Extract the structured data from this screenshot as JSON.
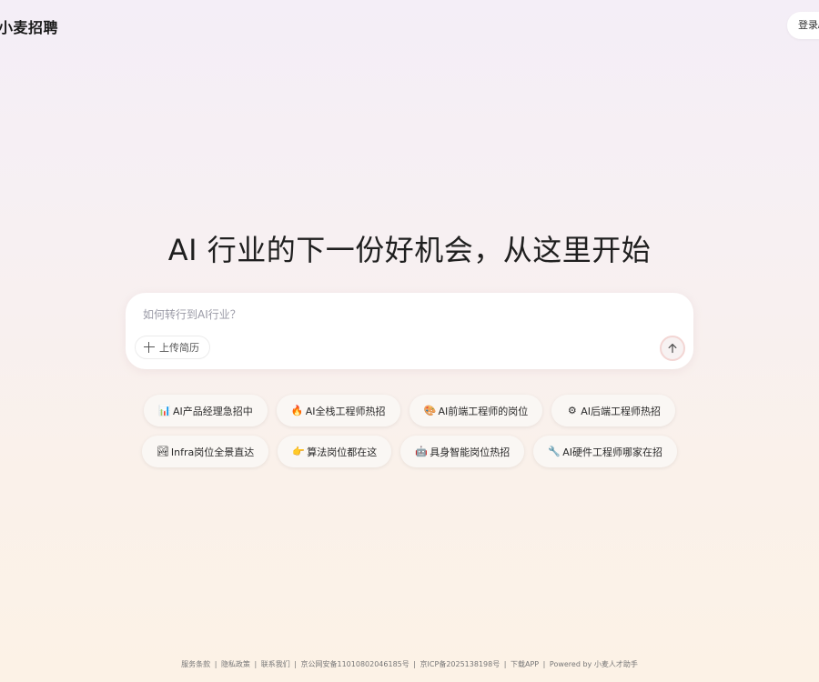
{
  "header": {
    "logo": "小麦招聘",
    "login_label": "登录/"
  },
  "hero": {
    "headline": "AI 行业的下一份好机会，从这里开始"
  },
  "search": {
    "placeholder": "如何转行到AI行业？",
    "value": "",
    "upload_label": "上传简历"
  },
  "chips": [
    {
      "icon": "📊",
      "icon_name": "bar-chart-icon",
      "label": "AI产品经理急招中"
    },
    {
      "icon": "🔥",
      "icon_name": "fire-icon",
      "label": "AI全栈工程师热招"
    },
    {
      "icon": "🎨",
      "icon_name": "palette-icon",
      "label": "AI前端工程师的岗位"
    },
    {
      "icon": "⚙",
      "icon_name": "gear-icon",
      "label": "AI后端工程师热招"
    },
    {
      "icon": "🏞",
      "icon_name": "landscape-icon",
      "label": "Infra岗位全景直达"
    },
    {
      "icon": "👉",
      "icon_name": "pointing-hand-icon",
      "label": "算法岗位都在这"
    },
    {
      "icon": "🤖",
      "icon_name": "robot-icon",
      "label": "具身智能岗位热招"
    },
    {
      "icon": "🔧",
      "icon_name": "wrench-icon",
      "label": "AI硬件工程师哪家在招"
    }
  ],
  "footer": {
    "links": [
      "服务条款",
      "隐私政策",
      "联系我们",
      "京公网安备11010802046185号",
      "京ICP备2025138198号",
      "下载APP",
      "Powered by 小麦人才助手"
    ]
  },
  "colors": {
    "send_ring": "#f3d6d4",
    "background_top": "#f4eef7",
    "background_bottom": "#fcf2e6"
  }
}
